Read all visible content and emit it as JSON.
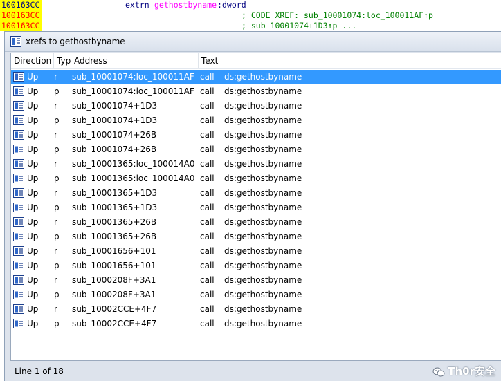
{
  "disasm": {
    "line1": {
      "addr": "100163CC",
      "kw": "extrn",
      "name": "gethostbyname",
      "sep": ":",
      "type": "dword"
    },
    "line2": {
      "addr": "100163CC",
      "comment": "; CODE XREF: sub_10001074:loc_100011AF↑p"
    },
    "line3": {
      "addr": "100163CC",
      "comment": "; sub_10001074+1D3↑p ..."
    }
  },
  "window": {
    "title": "xrefs to gethostbyname",
    "columns": [
      "Direction",
      "Typ",
      "Address",
      "Text"
    ],
    "rows": [
      {
        "dir": "Up",
        "type": "r",
        "address": "sub_10001074:loc_100011AF",
        "instr": "call",
        "operand": "ds:gethostbyname"
      },
      {
        "dir": "Up",
        "type": "p",
        "address": "sub_10001074:loc_100011AF",
        "instr": "call",
        "operand": "ds:gethostbyname"
      },
      {
        "dir": "Up",
        "type": "r",
        "address": "sub_10001074+1D3",
        "instr": "call",
        "operand": "ds:gethostbyname"
      },
      {
        "dir": "Up",
        "type": "p",
        "address": "sub_10001074+1D3",
        "instr": "call",
        "operand": "ds:gethostbyname"
      },
      {
        "dir": "Up",
        "type": "r",
        "address": "sub_10001074+26B",
        "instr": "call",
        "operand": "ds:gethostbyname"
      },
      {
        "dir": "Up",
        "type": "p",
        "address": "sub_10001074+26B",
        "instr": "call",
        "operand": "ds:gethostbyname"
      },
      {
        "dir": "Up",
        "type": "r",
        "address": "sub_10001365:loc_100014A0",
        "instr": "call",
        "operand": "ds:gethostbyname"
      },
      {
        "dir": "Up",
        "type": "p",
        "address": "sub_10001365:loc_100014A0",
        "instr": "call",
        "operand": "ds:gethostbyname"
      },
      {
        "dir": "Up",
        "type": "r",
        "address": "sub_10001365+1D3",
        "instr": "call",
        "operand": "ds:gethostbyname"
      },
      {
        "dir": "Up",
        "type": "p",
        "address": "sub_10001365+1D3",
        "instr": "call",
        "operand": "ds:gethostbyname"
      },
      {
        "dir": "Up",
        "type": "r",
        "address": "sub_10001365+26B",
        "instr": "call",
        "operand": "ds:gethostbyname"
      },
      {
        "dir": "Up",
        "type": "p",
        "address": "sub_10001365+26B",
        "instr": "call",
        "operand": "ds:gethostbyname"
      },
      {
        "dir": "Up",
        "type": "r",
        "address": "sub_10001656+101",
        "instr": "call",
        "operand": "ds:gethostbyname"
      },
      {
        "dir": "Up",
        "type": "p",
        "address": "sub_10001656+101",
        "instr": "call",
        "operand": "ds:gethostbyname"
      },
      {
        "dir": "Up",
        "type": "r",
        "address": "sub_1000208F+3A1",
        "instr": "call",
        "operand": "ds:gethostbyname"
      },
      {
        "dir": "Up",
        "type": "p",
        "address": "sub_1000208F+3A1",
        "instr": "call",
        "operand": "ds:gethostbyname"
      },
      {
        "dir": "Up",
        "type": "r",
        "address": "sub_10002CCE+4F7",
        "instr": "call",
        "operand": "ds:gethostbyname"
      },
      {
        "dir": "Up",
        "type": "p",
        "address": "sub_10002CCE+4F7",
        "instr": "call",
        "operand": "ds:gethostbyname"
      }
    ],
    "selected_index": 0,
    "status": "Line 1 of 18",
    "watermark": "Th0r安全",
    "icons": {
      "title": "xref-window-icon",
      "row": "xref-row-icon",
      "watermark": "wechat-icon"
    },
    "colors": {
      "selection": "#3399ff",
      "address_bg": "#ffff00",
      "symbol": "#ff00ff",
      "comment": "#008000"
    }
  }
}
